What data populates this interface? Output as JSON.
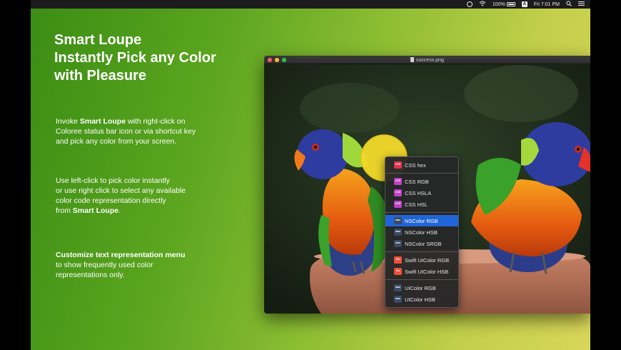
{
  "menubar": {
    "battery": "100%",
    "time": "Fri 7:01 PM",
    "keyboard_badge": "A"
  },
  "headline": {
    "line1": "Smart Loupe",
    "line2": "Instantly Pick any Color",
    "line3": "with Pleasure"
  },
  "paragraphs": {
    "p1": {
      "pre": "Invoke ",
      "bold": "Smart Loupe",
      "post": " with right-click on",
      "line2": "Coloree status bar icon or via shortcut key",
      "line3": "and pick any color from your screen."
    },
    "p2": {
      "line1": "Use left-click to pick color instantly",
      "line2": "or use right click to select any available",
      "line3": "color code representation directly",
      "line4_pre": "from ",
      "line4_bold": "Smart Loupe",
      "line4_post": "."
    },
    "p3": {
      "bold": "Customize text representation menu",
      "line2": "to show frequently used color",
      "line3": "representations only."
    }
  },
  "window": {
    "title": "success.png"
  },
  "menu": {
    "items": [
      {
        "label": "CSS hex",
        "badge": "CSS"
      },
      {
        "label": "CSS RGB",
        "badge": "CSS"
      },
      {
        "label": "CSS HSLA",
        "badge": "CSS"
      },
      {
        "label": "CSS HSL",
        "badge": "CSS"
      },
      {
        "label": "NSColor RGB",
        "badge": "mac"
      },
      {
        "label": "NSColor HSB",
        "badge": "mac"
      },
      {
        "label": "NSColor SRGB",
        "badge": "mac"
      },
      {
        "label": "Swift UIColor RGB",
        "badge": "Sw"
      },
      {
        "label": "Swift UIColor HSB",
        "badge": "Sw"
      },
      {
        "label": "UIColor RGB",
        "badge": "mac"
      },
      {
        "label": "UIColor HSB",
        "badge": "mac"
      }
    ]
  },
  "colors": {
    "selection": "#2066d8",
    "loupe": "#f2d92a"
  }
}
